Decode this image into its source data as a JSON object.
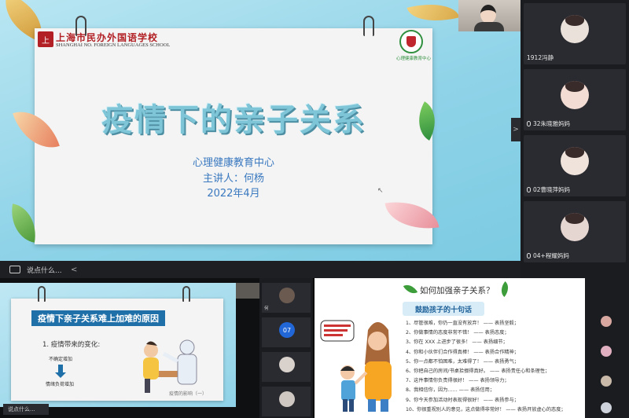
{
  "main_slide": {
    "school_name_cn": "上海市民办外国语学校",
    "school_name_en": "SHANGHAI NO. FOREIGN LANGUAGES SCHOOL",
    "center_logo_text": "心理健康教育中心",
    "title": "疫情下的亲子关系",
    "org": "心理健康教育中心",
    "speaker": "主讲人：何杨",
    "date": "2022年4月"
  },
  "chat": {
    "placeholder": "说点什么...",
    "collapse_glyph": "<"
  },
  "sidebar": {
    "toggle_glyph": ">",
    "tiles": [
      {
        "label": "1912冯静"
      },
      {
        "label": "32朱晓雅妈妈"
      },
      {
        "label": "02曹晓萍妈妈"
      },
      {
        "label": "04+程耀妈妈"
      }
    ]
  },
  "bottom_left": {
    "header": "疫情下亲子关系难上加难的原因",
    "cause": "1. 疫情带来的变化:",
    "line1": "不确定增加",
    "line2": "情绪负荷增加",
    "page": "疫情的影响（一）"
  },
  "bottom_middle": {
    "tiles": [
      {
        "label": "何"
      },
      {
        "label": "07",
        "avatar": "07"
      },
      {
        "label": ""
      },
      {
        "label": ""
      }
    ]
  },
  "bottom_right": {
    "title": "如何加强亲子关系？",
    "box": "鼓励孩子的十句话",
    "items": [
      "1、尽管很难，你仍一直没有放弃！ —— 表扬坚毅；",
      "2、你做事情的态度非常不错！ —— 表扬态度；",
      "3、你在 XXX 上进步了很多！ —— 表扬细节；",
      "4、你和小伙伴们合作得真棒！ —— 表扬合作精神；",
      "5、你一点都不怕困难，太难得了！ —— 表扬勇气；",
      "6、你把自己的房间/书桌拾掇得真好。 —— 表扬责任心和条理性；",
      "7、这件事情你负责得很好！ —— 表扬领导力；",
      "8、我相信你，因为…… —— 表扬信用；",
      "9、你今天参加活动时表现得很好！ —— 表扬参与；",
      "10、你很重视别人的意见，这点做得非常好！ —— 表扬开放虚心的态度；"
    ]
  }
}
